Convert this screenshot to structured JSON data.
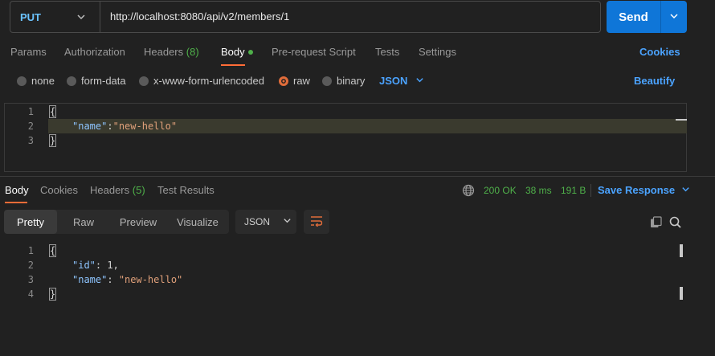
{
  "request": {
    "method": "PUT",
    "url": "http://localhost:8080/api/v2/members/1",
    "send_label": "Send"
  },
  "tabs": [
    {
      "label": "Params"
    },
    {
      "label": "Authorization"
    },
    {
      "label": "Headers",
      "count": "(8)"
    },
    {
      "label": "Body",
      "active": true
    },
    {
      "label": "Pre-request Script"
    },
    {
      "label": "Tests"
    },
    {
      "label": "Settings"
    }
  ],
  "cookies_label": "Cookies",
  "body_types": [
    {
      "label": "none"
    },
    {
      "label": "form-data"
    },
    {
      "label": "x-www-form-urlencoded"
    },
    {
      "label": "raw",
      "selected": true
    },
    {
      "label": "binary"
    }
  ],
  "body_format": "JSON",
  "beautify_label": "Beautify",
  "request_body": {
    "line_numbers": [
      "1",
      "2",
      "3"
    ],
    "open_brace": "{",
    "close_brace": "}",
    "key": "\"name\"",
    "colon": ":",
    "value": "\"new-hello\""
  },
  "response_tabs": [
    {
      "label": "Body",
      "active": true
    },
    {
      "label": "Cookies"
    },
    {
      "label": "Headers",
      "count": "(5)"
    },
    {
      "label": "Test Results"
    }
  ],
  "response_meta": {
    "status": "200 OK",
    "time": "38 ms",
    "size": "191 B",
    "save_label": "Save Response"
  },
  "view_modes": [
    {
      "label": "Pretty",
      "active": true
    },
    {
      "label": "Raw"
    },
    {
      "label": "Preview"
    },
    {
      "label": "Visualize"
    }
  ],
  "response_format": "JSON",
  "response_body": {
    "line_numbers": [
      "1",
      "2",
      "3",
      "4"
    ],
    "open_brace": "{",
    "close_brace": "}",
    "id_key": "\"id\"",
    "id_colon": ": ",
    "id_value": "1",
    "id_comma": ",",
    "name_key": "\"name\"",
    "name_colon": ": ",
    "name_value": "\"new-hello\""
  },
  "colors": {
    "accent_orange": "#ff6c37",
    "link_blue": "#4ba3ff",
    "send_blue": "#0f76d8",
    "success_green": "#4fb04a",
    "background": "#212121"
  },
  "icons": [
    "chevron-down-icon",
    "globe-icon",
    "copy-icon",
    "search-icon",
    "wrap-lines-icon"
  ]
}
